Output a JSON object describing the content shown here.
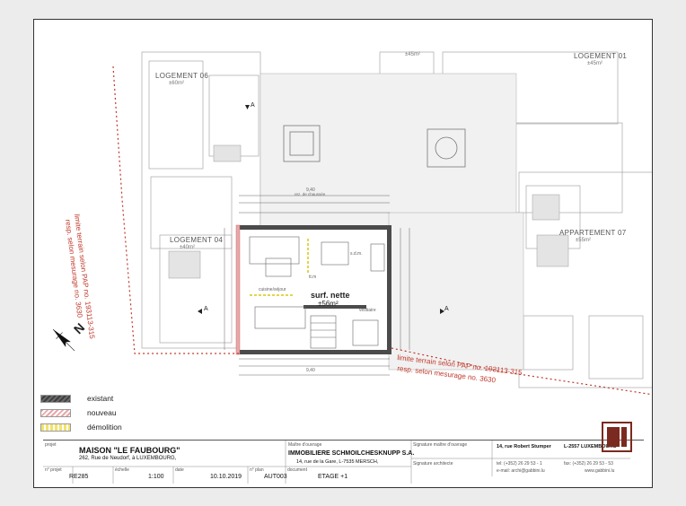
{
  "legend": {
    "existing": "existant",
    "new": "nouveau",
    "demolition": "démolition",
    "colors": {
      "existing": "#6b6b6b",
      "new": "#e8a8a8",
      "demolition": "#f2e36b"
    }
  },
  "plan": {
    "apartments": [
      {
        "name": "LOGEMENT 06",
        "area": "±60m²"
      },
      {
        "name": "LOGEMENT 04",
        "area": "±40m²"
      },
      {
        "name": "LOGEMENT 01",
        "area": "±45m²"
      },
      {
        "name": "APPARTEMENT 07",
        "area": "±55m²"
      },
      {
        "name": "",
        "area": "±45m²"
      }
    ],
    "surf_label": "surf. nette",
    "surf_value": "±56m²",
    "room_labels": [
      "cuisine/séjour",
      "s.d.m.",
      "vestiaire",
      "rez. de chaussée",
      "tt.m"
    ],
    "section_markers": [
      "A",
      "A",
      "A"
    ],
    "boundary_lines": [
      "limite terrain selon PAP no. 193113-315",
      "resp. selon mesurage no. 3630"
    ],
    "dim_labels": {
      "top": "9,40",
      "bottom": "9,40"
    },
    "north_symbol": "N"
  },
  "title_block": {
    "projet_caption": "projet",
    "projet_name": "MAISON \"LE FAUBOURG\"",
    "projet_address": "262, Rue de Neudorf, à LUXEMBOURG,",
    "maitre_caption": "Maître d'ouvrage",
    "maitre_name": "IMMOBILIERE SCHMOILCHESKNUPP S.A.",
    "maitre_address": "14, rue de la Gare, L-7535 MERSCH,",
    "signature_mo": "Signature maître d'ouvrage",
    "signature_arch": "Signature architecte",
    "office_street": "14, rue Robert Stumper",
    "office_city": "L-2557 LUXEMBOURG",
    "office_tel": "tel: (+352) 26 29 53 - 1",
    "office_fax": "fax: (+352) 26 29 53 - 53",
    "office_email": "e-mail: archi@gabbini.lu",
    "office_web": "www.gabbini.lu",
    "fields": {
      "n_projet_caption": "n° projet",
      "n_projet": "RE285",
      "echelle_caption": "échelle",
      "echelle": "1:100",
      "date_caption": "date",
      "date": "10.10.2019",
      "n_plan_caption": "n° plan",
      "n_plan": "AUT003",
      "document_caption": "document",
      "document": "ETAGE +1"
    },
    "logo_text": "iPlan"
  }
}
